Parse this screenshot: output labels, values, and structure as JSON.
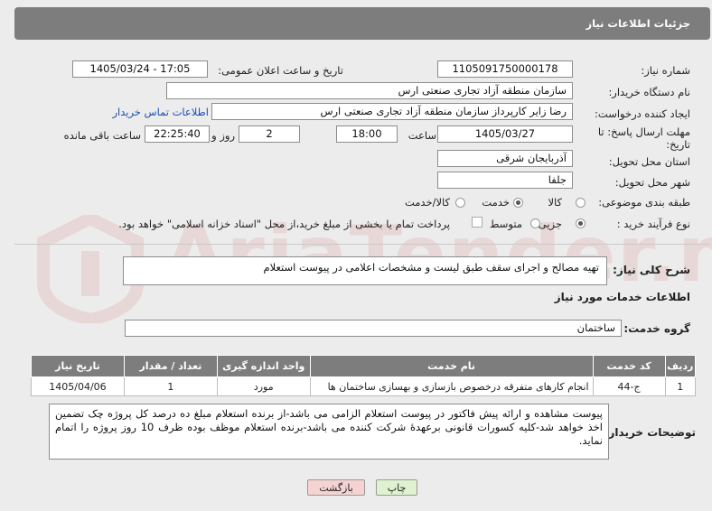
{
  "header": {
    "title": "جزئیات اطلاعات نیاز"
  },
  "labels": {
    "need_number": "شماره نیاز:",
    "announce_datetime": "تاریخ و ساعت اعلان عمومی:",
    "buyer_org": "نام دستگاه خریدار:",
    "requester": "ایجاد کننده درخواست:",
    "buyer_contact_link": "اطلاعات تماس خریدار",
    "deadline_line1": "مهلت ارسال پاسخ: تا",
    "deadline_line2": "تاریخ:",
    "time_word": "ساعت",
    "day_and_word": "روز و",
    "remaining_word": "ساعت باقی مانده",
    "province": "استان محل تحویل:",
    "city": "شهر محل تحویل:",
    "category": "طبقه بندی موضوعی:",
    "purchase_type": "نوع فرآیند خرید :",
    "description_title": "شرح کلی نیاز:",
    "services_info_title": "اطلاعات خدمات مورد نیاز",
    "service_group": "گروه خدمت:",
    "buyer_notes": "توضیحات خریدار:"
  },
  "fields": {
    "need_number": "1105091750000178",
    "announce_datetime": "1405/03/24 - 17:05",
    "buyer_org": "سازمان منطقه آزاد تجاری صنعتی ارس",
    "requester": "رضا زایر کارپرداز سازمان منطقه آزاد تجاری صنعتی ارس",
    "deadline_date": "1405/03/27",
    "deadline_time": "18:00",
    "days_remaining": "2",
    "time_remaining": "22:25:40",
    "province": "آذربایجان شرقی",
    "city": "جلفا",
    "need_description": "تهیه مصالح و اجرای سقف طبق لیست و مشخصات اعلامی در پیوست استعلام",
    "service_group": "ساختمان",
    "buyer_notes": "پیوست مشاهده و ارائه پیش فاکتور در پیوست استعلام الزامی می باشد-از برنده استعلام مبلغ ده درصد کل پروژه چک تضمین اخذ خواهد شد-کلیه کسورات قانونی برعهدهٔ شرکت کننده می باشد-برنده استعلام موظف بوده ظرف 10 روز پروژه را اتمام نماید."
  },
  "category_options": [
    {
      "label": "کالا",
      "selected": false
    },
    {
      "label": "خدمت",
      "selected": true
    },
    {
      "label": "کالا/خدمت",
      "selected": false
    }
  ],
  "purchase_options": [
    {
      "label": "جزیی",
      "selected": true
    },
    {
      "label": "متوسط",
      "selected": false
    }
  ],
  "payment_note": "پرداخت تمام یا بخشی از مبلغ خرید،از محل \"اسناد خزانه اسلامی\" خواهد بود.",
  "table": {
    "headers": [
      "ردیف",
      "کد خدمت",
      "نام خدمت",
      "واحد اندازه گیری",
      "تعداد / مقدار",
      "تاریخ نیاز"
    ],
    "rows": [
      [
        "1",
        "ج-44",
        "انجام کارهای متفرقه درخصوص بازسازی و بهسازی ساختمان ها",
        "مورد",
        "1",
        "1405/04/06"
      ]
    ]
  },
  "buttons": {
    "print": "چاپ",
    "back": "بازگشت"
  },
  "watermark": {
    "text": "AriaTender.neT"
  },
  "colors": {
    "header_bg": "#7d7d7d",
    "link": "#1a4fb5",
    "back_btn_bg": "#f6d3d3",
    "print_btn_bg": "#dff2cf"
  }
}
